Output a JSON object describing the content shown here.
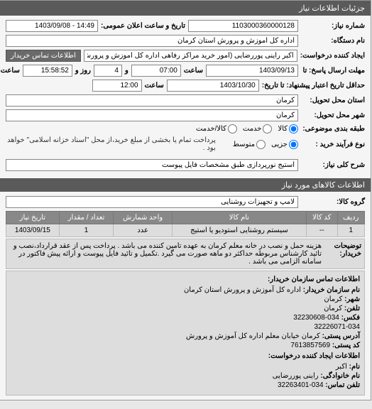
{
  "title_bar": "جزئیات اطلاعات نیاز",
  "labels": {
    "number": "شماره نیاز:",
    "datetime": "تاریخ و ساعت اعلان عمومی:",
    "device": "نام دستگاه:",
    "requester": "ایجاد کننده درخواست:",
    "deadline_from": "مهلت ارسال پاسخ: تا",
    "deadline_to": "حداقل تاریخ اعتبار پیشنهاد: تا تاریخ:",
    "hour": "ساعت",
    "and": "و",
    "day": "روز و",
    "remaining": "ساعت باقی مانده",
    "province": "استان محل تحویل:",
    "city": "شهر محل تحویل:",
    "category": "طبقه بندی موضوعی:",
    "process": "نوع فرآیند خرید :",
    "summary": "شرح کلی نیاز:",
    "group": "گروه کالا:"
  },
  "values": {
    "number": "1103000360000128",
    "datetime": "14:49 - 1403/09/08",
    "device": "اداره کل آموزش و پرورش استان کرمان",
    "requester": "اکبر راینی پوررضایی (امور خرید مراکز رفاهی اداره کل آموزش و پرورش استان کر",
    "date1": "1403/09/13",
    "time1": "07:00",
    "days": "4",
    "remain": "15:58:52",
    "date2": "1403/10/30",
    "time2": "12:00",
    "province": "کرمان",
    "city": "کرمان",
    "summary": "استیج نورپردازی طبق مشخصات فایل پیوست",
    "group": "لامپ و تجهیزات روشنایی"
  },
  "buttons": {
    "contact_buyer": "اطلاعات تماس خریدار"
  },
  "radios": {
    "cat_goods": "کالا",
    "cat_service": "خدمت",
    "cat_both": "کالا/خدمت",
    "proc_low": "جزیی",
    "proc_mid": "متوسط"
  },
  "note": "پرداخت تمام یا بخشی از مبلغ خرید،از محل \"اسناد خزانه اسلامی\" خواهد بود .",
  "items_header": "اطلاعات کالاهای مورد نیاز",
  "table": {
    "headers": [
      "ردیف",
      "کد کالا",
      "نام کالا",
      "واحد شمارش",
      "تعداد / مقدار",
      "تاریخ نیاز"
    ],
    "row": [
      "1",
      "--",
      "سیستم روشنایی استودیو یا استیج",
      "عدد",
      "1",
      "1403/09/15"
    ]
  },
  "desc": {
    "label": "توضیحات خریدار:",
    "text": "هزینه حمل و نصب در خانه معلم کرمان به عهده تامین کننده می باشد . پرداخت پس از عقد قرارداد،نصب و تائید کارشناس مربوطه حداکثر دو ماهه صورت می گیرد .تکمیل و تائید فایل پیوست و ارائه پیش فاکتور در سامانه الزامی می باشد ."
  },
  "contact": {
    "title": "اطلاعات تماس سازمان خریدار:",
    "org_k": "نام سازمان خریدار:",
    "org_v": "اداره کل آموزش و پرورش استان کرمان",
    "city_k": "شهر:",
    "city_v": "کرمان",
    "phone_k": "تلفن:",
    "phone_v": "کرمان",
    "fax_k": "فکس:",
    "fax_v": "034-32230608",
    "fax2": "32226071-034",
    "addr_k": "آدرس پستی:",
    "addr_v": "کرمان خیابان معلم اداره کل آموزش و پرورش",
    "zip_k": "کد پستی:",
    "zip_v": "7613857569",
    "req_title": "اطلاعات ایجاد کننده درخواست:",
    "name_k": "نام:",
    "name_v": "اکبر",
    "lname_k": "نام خانوادگی:",
    "lname_v": "راینی پوررضایی",
    "tel_k": "تلفن تماس:",
    "tel_v": "034-32263401"
  }
}
